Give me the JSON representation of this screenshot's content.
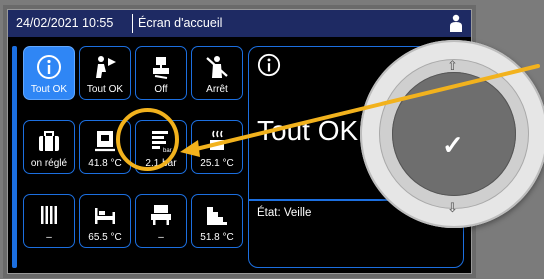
{
  "topbar": {
    "datetime": "24/02/2021 10:55",
    "title": "Écran d'accueil"
  },
  "tiles": [
    {
      "name": "tile-tout-ok-active",
      "label": "Tout OK",
      "icon": "info-icon"
    },
    {
      "name": "tile-tout-ok",
      "label": "Tout OK",
      "icon": "person-fan-icon"
    },
    {
      "name": "tile-off",
      "label": "Off",
      "icon": "hot-water-icon"
    },
    {
      "name": "tile-arret",
      "label": "Arrêt",
      "icon": "person-off-icon"
    },
    {
      "name": "tile-non-regle",
      "label": "on réglé",
      "icon": "suitcase-icon"
    },
    {
      "name": "tile-41-8",
      "label": "41.8 °C",
      "icon": "boiler-icon"
    },
    {
      "name": "tile-pressure",
      "label": "2.1 bar",
      "icon": "pressure-bar-icon"
    },
    {
      "name": "tile-25-1",
      "label": "25.1 °C",
      "icon": "outdoor-temp-icon"
    },
    {
      "name": "tile-radiator",
      "label": "–",
      "icon": "radiator-icon"
    },
    {
      "name": "tile-65-5",
      "label": "65.5 °C",
      "icon": "bed-icon"
    },
    {
      "name": "tile-seat",
      "label": "–",
      "icon": "seat-icon"
    },
    {
      "name": "tile-51-8",
      "label": "51.8 °C",
      "icon": "stairs-icon"
    }
  ],
  "panel": {
    "status_big": "Tout OK",
    "etat": "État: Veille"
  },
  "knob": {
    "confirm_symbol": "✓",
    "up_symbol": "⇧",
    "down_symbol": "⇩"
  },
  "colors": {
    "accent_blue": "#1c6fe0",
    "active_tile": "#2f86f5",
    "highlight": "#f2b21d",
    "topbar": "#1e2a63"
  }
}
